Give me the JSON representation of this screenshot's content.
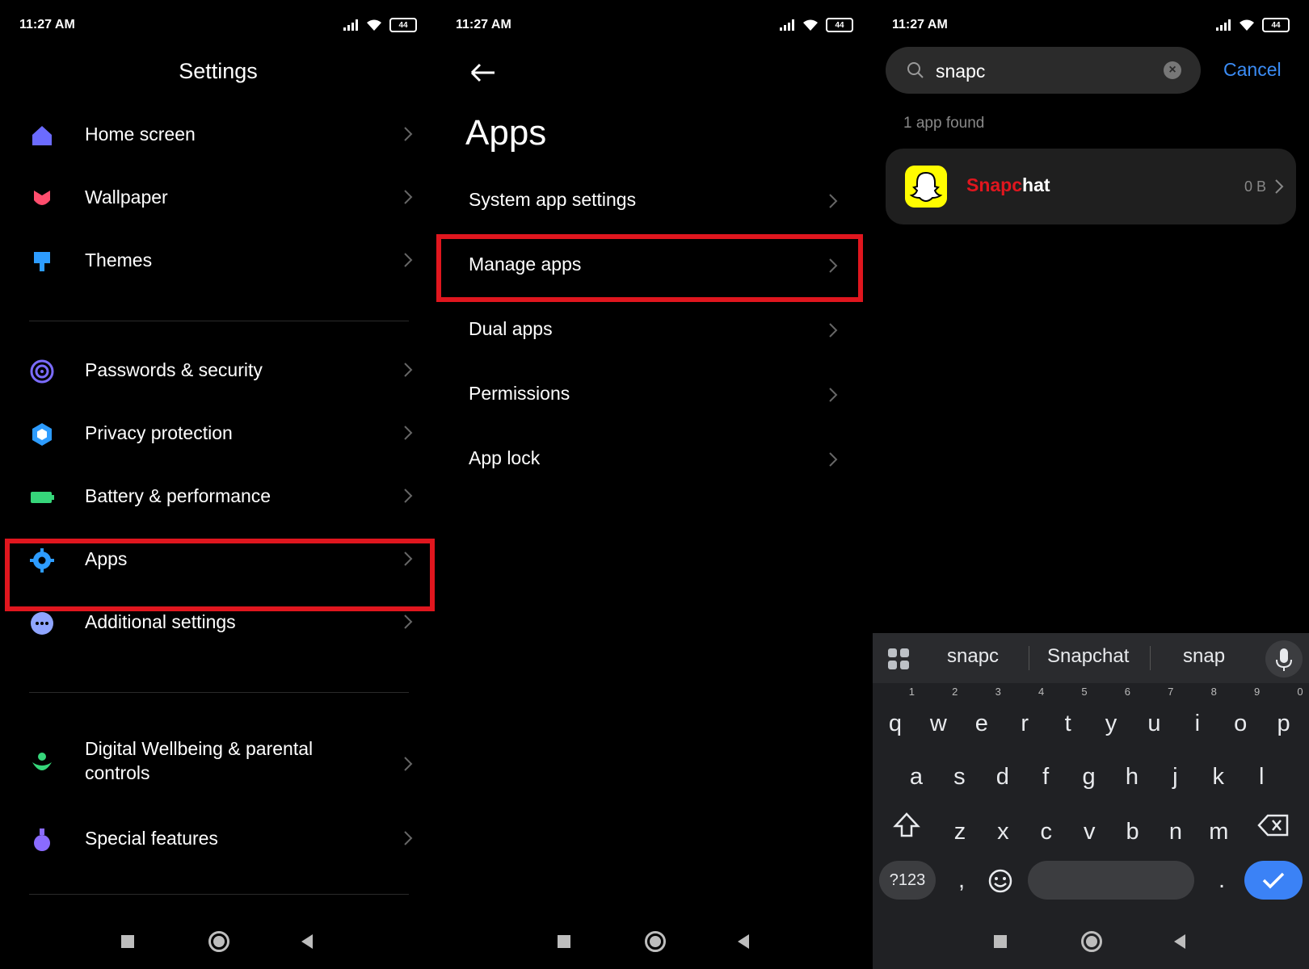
{
  "status": {
    "time": "11:27 AM",
    "battery": "44"
  },
  "settings": {
    "title": "Settings",
    "items": [
      {
        "label": "Home screen",
        "color": "#6b6bff"
      },
      {
        "label": "Wallpaper",
        "color": "#ff4d6d"
      },
      {
        "label": "Themes",
        "color": "#2d9cff"
      },
      {
        "label": "Passwords & security",
        "color": "#7b6cff"
      },
      {
        "label": "Privacy protection",
        "color": "#2d9cff"
      },
      {
        "label": "Battery & performance",
        "color": "#36d67a"
      },
      {
        "label": "Apps",
        "color": "#2d9cff"
      },
      {
        "label": "Additional settings",
        "color": "#8fa5ff"
      },
      {
        "label": "Digital Wellbeing & parental controls",
        "color": "#36d67a"
      },
      {
        "label": "Special features",
        "color": "#8a6bff"
      }
    ]
  },
  "apps": {
    "title": "Apps",
    "items": [
      {
        "label": "System app settings"
      },
      {
        "label": "Manage apps"
      },
      {
        "label": "Dual apps"
      },
      {
        "label": "Permissions"
      },
      {
        "label": "App lock"
      }
    ]
  },
  "search": {
    "query": "snapc",
    "cancel": "Cancel",
    "result_count": "1 app found",
    "result": {
      "name_highlight": "Snapc",
      "name_rest": "hat",
      "size": "0 B"
    }
  },
  "keyboard": {
    "suggestions": [
      "snapc",
      "Snapchat",
      "snap"
    ],
    "row1": [
      [
        "q",
        "1"
      ],
      [
        "w",
        "2"
      ],
      [
        "e",
        "3"
      ],
      [
        "r",
        "4"
      ],
      [
        "t",
        "5"
      ],
      [
        "y",
        "6"
      ],
      [
        "u",
        "7"
      ],
      [
        "i",
        "8"
      ],
      [
        "o",
        "9"
      ],
      [
        "p",
        "0"
      ]
    ],
    "row2": [
      "a",
      "s",
      "d",
      "f",
      "g",
      "h",
      "j",
      "k",
      "l"
    ],
    "row3": [
      "z",
      "x",
      "c",
      "v",
      "b",
      "n",
      "m"
    ],
    "symbols": "?123",
    "comma": ",",
    "period": "."
  },
  "accent": "#e0161e"
}
